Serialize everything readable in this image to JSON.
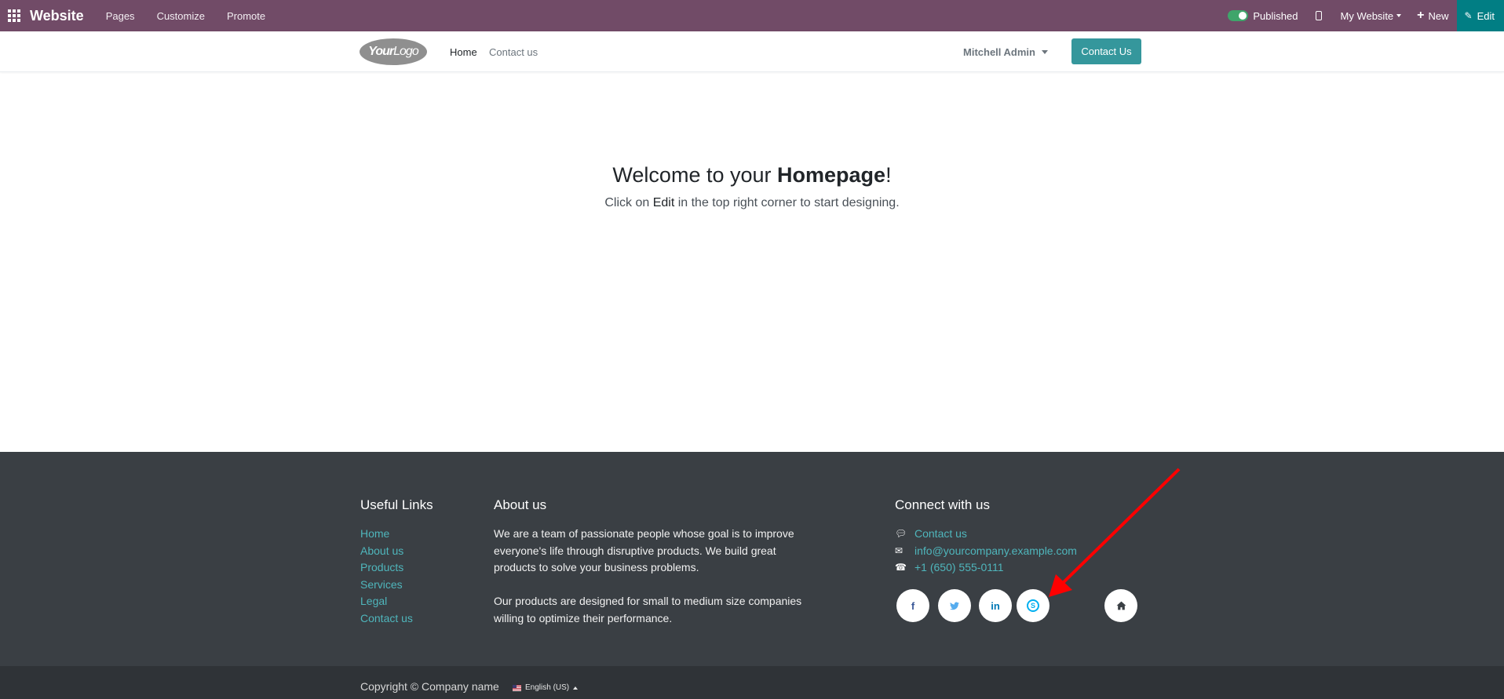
{
  "topbar": {
    "brand": "Website",
    "nav": [
      "Pages",
      "Customize",
      "Promote"
    ],
    "published_label": "Published",
    "my_website_label": "My Website",
    "new_label": "New",
    "edit_label": "Edit"
  },
  "header": {
    "logo_text_bold": "Your",
    "logo_text_light": "Logo",
    "nav_home": "Home",
    "nav_contact": "Contact us",
    "user_name": "Mitchell Admin",
    "contact_button": "Contact Us"
  },
  "hero": {
    "title_prefix": "Welcome to your ",
    "title_bold": "Homepage",
    "title_suffix": "!",
    "sub_prefix": "Click on ",
    "sub_edit": "Edit",
    "sub_suffix": " in the top right corner to start designing."
  },
  "footer": {
    "useful_links_title": "Useful Links",
    "useful_links": [
      "Home",
      "About us",
      "Products",
      "Services",
      "Legal",
      "Contact us"
    ],
    "about_title": "About us",
    "about_p1": "We are a team of passionate people whose goal is to improve everyone's life through disruptive products. We build great products to solve your business problems.",
    "about_p2": "Our products are designed for small to medium size companies willing to optimize their performance.",
    "connect_title": "Connect with us",
    "contact_us": "Contact us",
    "email": "info@yourcompany.example.com",
    "phone": "+1 (650) 555-0111",
    "social_icons": [
      "facebook-icon",
      "twitter-icon",
      "linkedin-icon",
      "skype-icon",
      "home-icon"
    ]
  },
  "copyright": {
    "text": "Copyright © Company name",
    "language": "English (US)"
  },
  "colors": {
    "topbar": "#714B67",
    "edit_button": "#017E84",
    "accent": "#35979C",
    "footer_bg": "#3a3f44",
    "annotation_arrow": "#ff0000"
  }
}
